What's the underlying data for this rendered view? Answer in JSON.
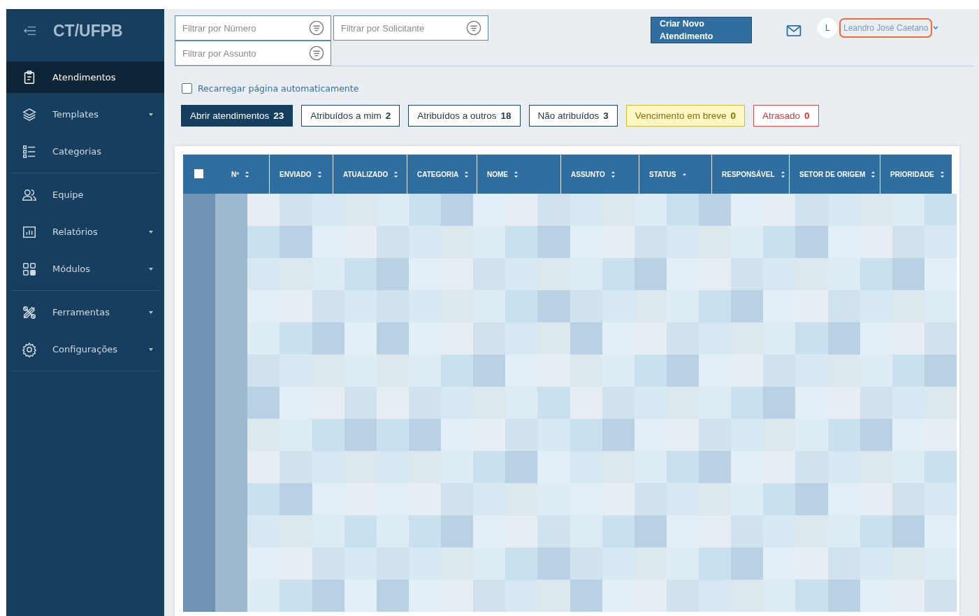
{
  "sidebar": {
    "brand": "CT/UFPB",
    "items": [
      {
        "label": "Atendimentos",
        "selected": true,
        "expandable": false,
        "divider_after": false
      },
      {
        "label": "Templates",
        "selected": false,
        "expandable": true,
        "divider_after": false
      },
      {
        "label": "Categorias",
        "selected": false,
        "expandable": false,
        "divider_after": true
      },
      {
        "label": "Equipe",
        "selected": false,
        "expandable": false,
        "divider_after": false
      },
      {
        "label": "Relatórios",
        "selected": false,
        "expandable": true,
        "divider_after": false
      },
      {
        "label": "Módulos",
        "selected": false,
        "expandable": true,
        "divider_after": true
      },
      {
        "label": "Ferramentas",
        "selected": false,
        "expandable": true,
        "divider_after": false
      },
      {
        "label": "Configurações",
        "selected": false,
        "expandable": true,
        "divider_after": true
      }
    ]
  },
  "filters": [
    {
      "placeholder": "Filtrar por Número"
    },
    {
      "placeholder": "Filtrar por Solicitante"
    },
    {
      "placeholder": "Filtrar por Assunto"
    }
  ],
  "create_button": "Criar Novo Atendimento",
  "user": {
    "initial": "L",
    "name": "Leandro José Caetano"
  },
  "auto_reload": {
    "label": "Recarregar página automaticamente",
    "checked": false
  },
  "tabs": [
    {
      "label": "Abrir atendimentos",
      "count": "23",
      "kind": "plain",
      "selected": true
    },
    {
      "label": "Atribuídos a mim",
      "count": "2",
      "kind": "plain",
      "selected": false
    },
    {
      "label": "Atribuídos a outros",
      "count": "18",
      "kind": "plain",
      "selected": false
    },
    {
      "label": "Não atribuídos",
      "count": "3",
      "kind": "plain",
      "selected": false
    },
    {
      "label": "Vencimento em breve",
      "count": "0",
      "kind": "warning",
      "selected": false
    },
    {
      "label": "Atrasado",
      "count": "0",
      "kind": "danger",
      "selected": false
    }
  ],
  "table": {
    "select_all": {
      "checked": false
    },
    "columns": [
      {
        "label": "Nº",
        "sorted": false
      },
      {
        "label": "ENVIADO",
        "sorted": false
      },
      {
        "label": "ATUALIZADO",
        "sorted": false
      },
      {
        "label": "CATEGORIA",
        "sorted": false
      },
      {
        "label": "NOME",
        "sorted": false
      },
      {
        "label": "ASSUNTO",
        "sorted": false
      },
      {
        "label": "STATUS",
        "sorted": true
      },
      {
        "label": "RESPONSÁVEL",
        "sorted": false
      },
      {
        "label": "SETOR DE ORIGEM",
        "sorted": false
      },
      {
        "label": "PRIORIDADE",
        "sorted": false
      }
    ]
  }
}
